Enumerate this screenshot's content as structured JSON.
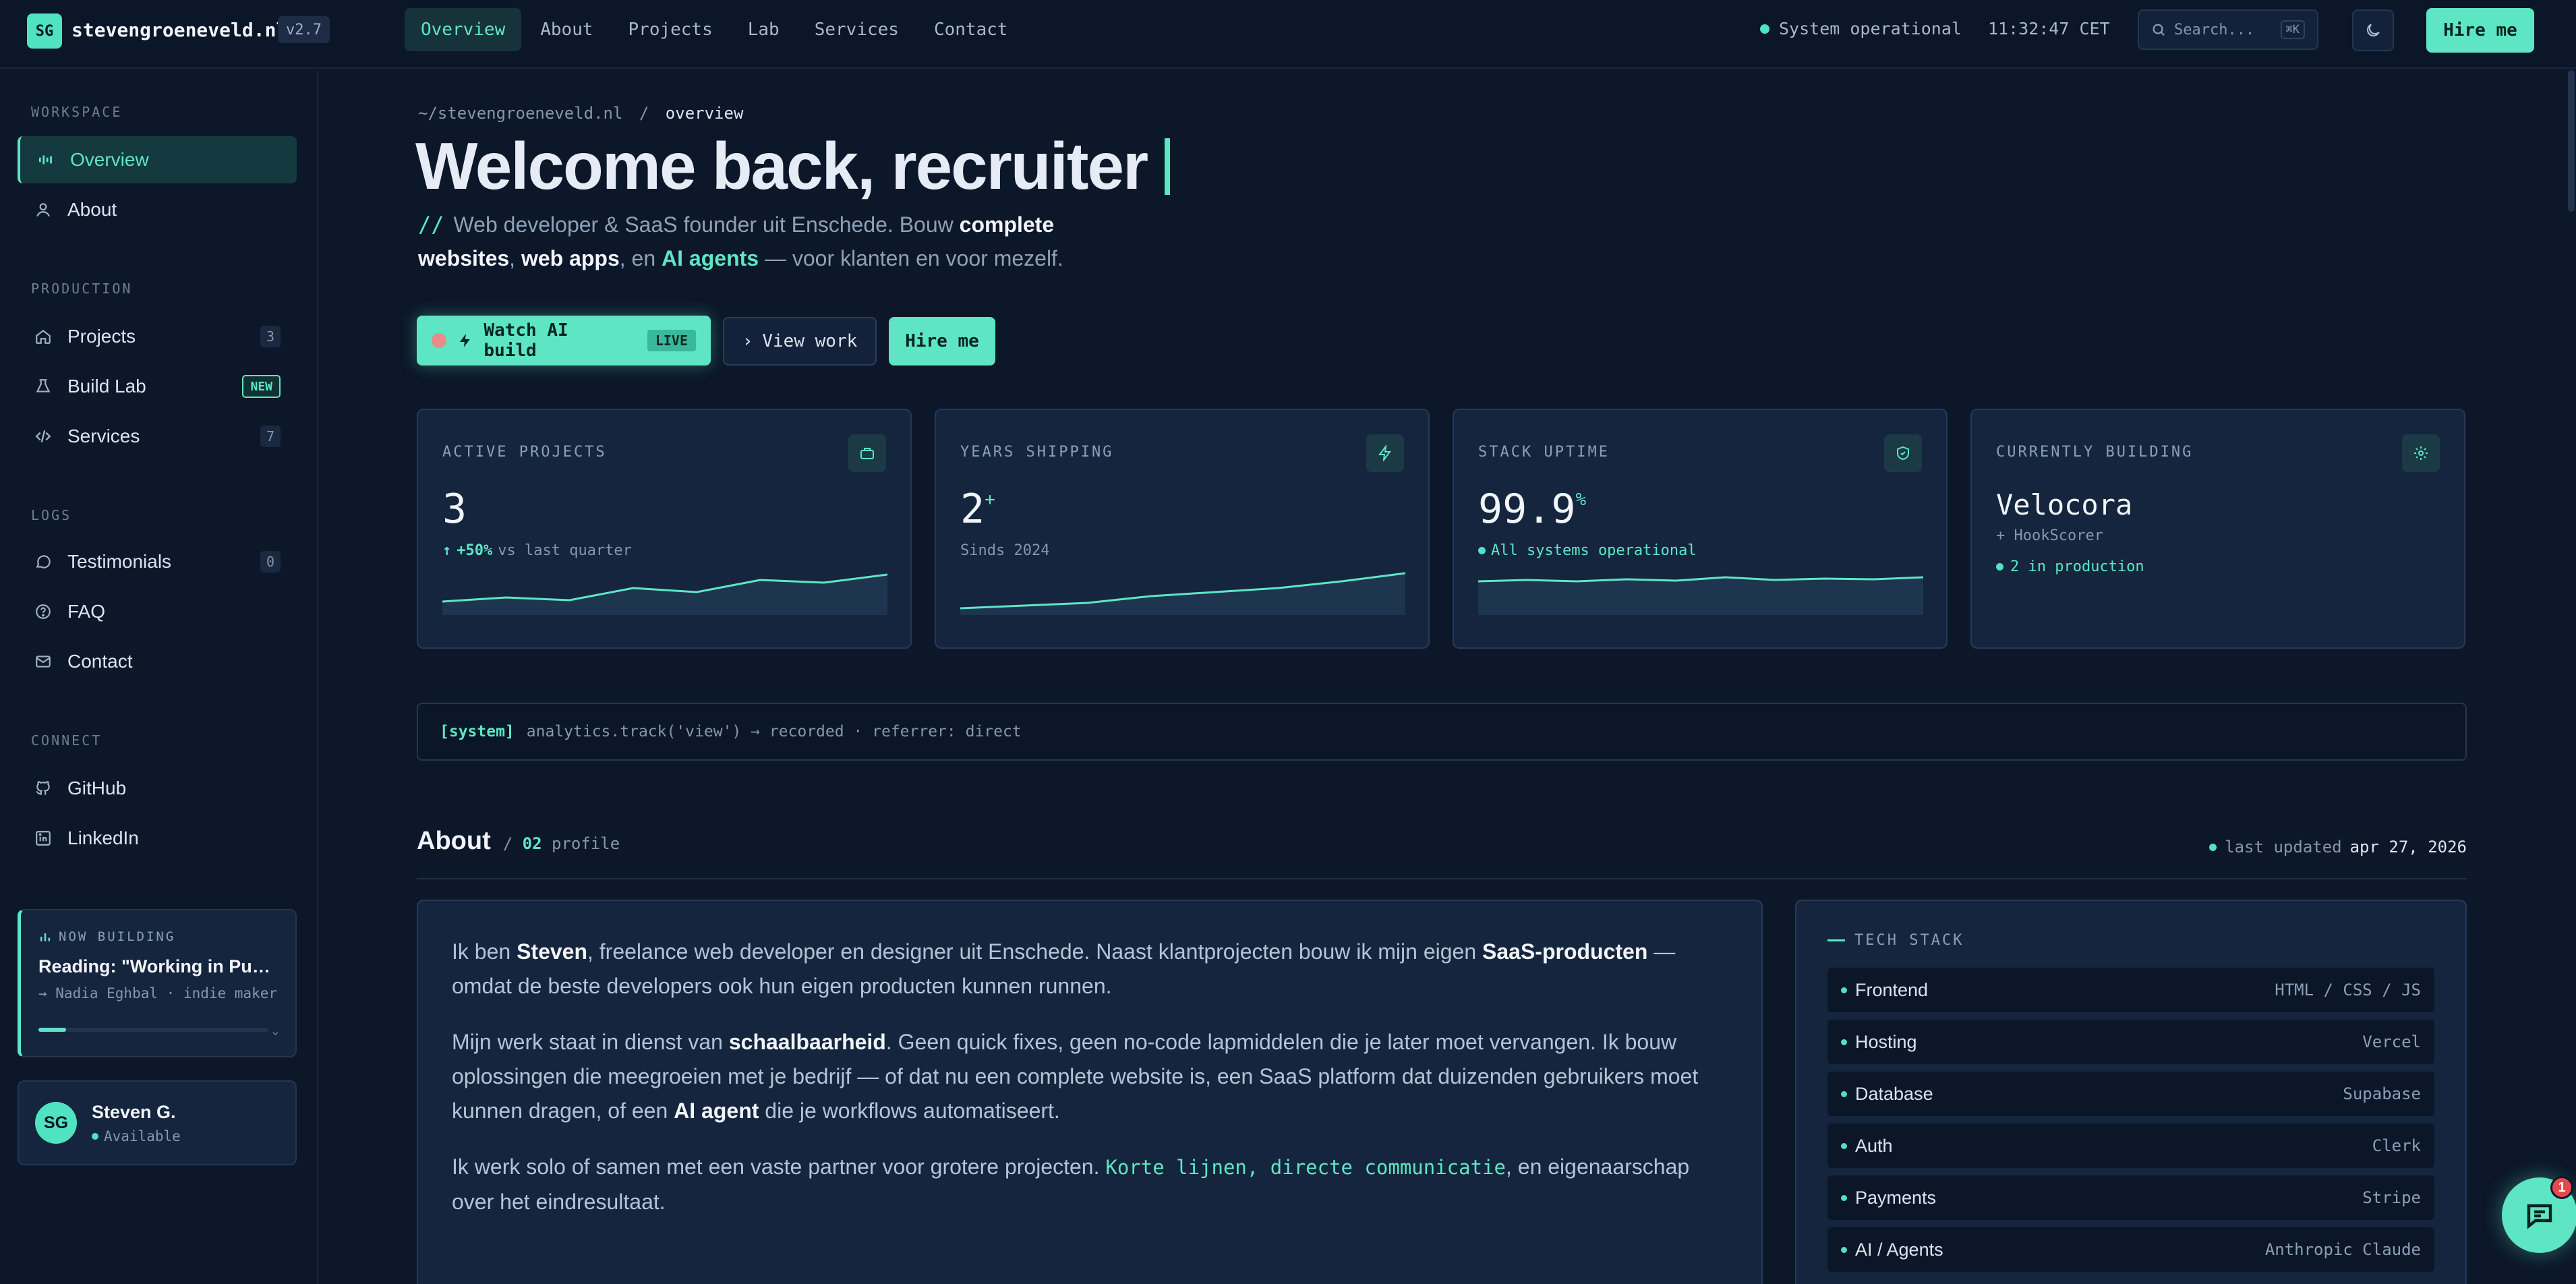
{
  "header": {
    "logo": "SG",
    "site_name": "stevengroeneveld.nl",
    "version": "v2.7",
    "nav": [
      {
        "label": "Overview",
        "active": true
      },
      {
        "label": "About"
      },
      {
        "label": "Projects"
      },
      {
        "label": "Lab"
      },
      {
        "label": "Services"
      },
      {
        "label": "Contact"
      }
    ],
    "status": "System operational",
    "clock": "11:32:47 CET",
    "search_placeholder": "Search...",
    "search_shortcut": "⌘K",
    "theme_icon": "moon-icon",
    "hire_label": "Hire me"
  },
  "sidebar": {
    "sections": {
      "workspace": "WORKSPACE",
      "production": "PRODUCTION",
      "logs": "LOGS",
      "connect": "CONNECT"
    },
    "items": {
      "overview": {
        "label": "Overview",
        "icon": "activity-icon"
      },
      "about": {
        "label": "About",
        "icon": "user-icon"
      },
      "projects": {
        "label": "Projects",
        "icon": "home-icon",
        "count": "3"
      },
      "build_lab": {
        "label": "Build Lab",
        "icon": "flask-icon",
        "badge": "NEW"
      },
      "services": {
        "label": "Services",
        "icon": "code-icon",
        "count": "7"
      },
      "testimonials": {
        "label": "Testimonials",
        "icon": "message-icon",
        "count": "0"
      },
      "faq": {
        "label": "FAQ",
        "icon": "help-icon"
      },
      "contact": {
        "label": "Contact",
        "icon": "mail-icon"
      },
      "github": {
        "label": "GitHub",
        "icon": "github-icon"
      },
      "linkedin": {
        "label": "LinkedIn",
        "icon": "linkedin-icon"
      }
    },
    "now_building": {
      "label": "NOW BUILDING",
      "title": "Reading: \"Working in Public\"",
      "subtitle": "→ Nadia Eghbal · indie maker",
      "progress": 0.12
    },
    "profile": {
      "initials": "SG",
      "name": "Steven G.",
      "status": "Available"
    }
  },
  "main": {
    "breadcrumb_root": "~/stevengroeneveld.nl",
    "breadcrumb_sep": "/",
    "breadcrumb_current": "overview",
    "title": "Welcome back, recruiter",
    "subtitle": {
      "slashes": "//",
      "p1": "Web developer & SaaS founder uit Enschede. Bouw ",
      "b1": "complete websites",
      "p2": ", ",
      "b2": "web apps",
      "p3": ", en ",
      "b3": "AI agents",
      "p4": " — voor klanten en voor mezelf."
    },
    "buttons": {
      "watch": "Watch AI build",
      "live": "LIVE",
      "view": "View work",
      "hire": "Hire me"
    },
    "stats": [
      {
        "label": "ACTIVE PROJECTS",
        "value": "3",
        "icon": "briefcase-icon",
        "delta": "+50%",
        "note": "vs last quarter",
        "spark": [
          20,
          26,
          22,
          40,
          34,
          52,
          48,
          60
        ]
      },
      {
        "label": "YEARS SHIPPING",
        "value": "2",
        "sup": "+",
        "icon": "bolt-icon",
        "note": "Sinds 2024",
        "spark": [
          10,
          14,
          18,
          28,
          34,
          40,
          50,
          62
        ]
      },
      {
        "label": "STACK UPTIME",
        "value": "99.9",
        "sup": "%",
        "icon": "shield-icon",
        "note": "All systems operational",
        "spark": [
          50,
          52,
          50,
          53,
          51,
          56,
          52,
          54,
          53,
          56
        ]
      },
      {
        "label": "CURRENTLY BUILDING",
        "value": "Velocora",
        "icon": "gear-icon",
        "note": "+ HookScorer",
        "note2": "2 in production"
      }
    ],
    "syslog": {
      "tag": "[system]",
      "text": "analytics.track('view') → recorded · referrer: direct"
    },
    "about": {
      "heading": "About",
      "sep": "/",
      "num": "02",
      "sub": "profile",
      "updated_label": "last updated",
      "updated_date": "apr 27, 2026",
      "p1": {
        "a": "Ik ben ",
        "b": "Steven",
        "c": ", freelance web developer en designer uit Enschede. Naast klantprojecten bouw ik mijn eigen ",
        "d": "SaaS-producten",
        "e": " — omdat de beste developers ook hun eigen producten kunnen runnen."
      },
      "p2": {
        "a": "Mijn werk staat in dienst van ",
        "b": "schaalbaarheid",
        "c": ". Geen quick fixes, geen no-code lapmiddelen die je later moet vervangen. Ik bouw oplossingen die meegroeien met je bedrijf — of dat nu een complete website is, een SaaS platform dat duizenden gebruikers moet kunnen dragen, of een ",
        "d": "AI agent",
        "e": " die je workflows automatiseert."
      },
      "p3": {
        "a": "Ik werk solo of samen met een vaste partner voor grotere projecten. ",
        "b": "Korte lijnen, directe communicatie",
        "c": ", en eigenaarschap over het eindresultaat."
      }
    },
    "tech_stack": {
      "title": "TECH STACK",
      "rows": [
        {
          "k": "Frontend",
          "v": "HTML / CSS / JS"
        },
        {
          "k": "Hosting",
          "v": "Vercel"
        },
        {
          "k": "Database",
          "v": "Supabase"
        },
        {
          "k": "Auth",
          "v": "Clerk"
        },
        {
          "k": "Payments",
          "v": "Stripe"
        },
        {
          "k": "AI / Agents",
          "v": "Anthropic Claude"
        }
      ]
    },
    "chat_badge": "1"
  },
  "colors": {
    "accent": "#5ee6c4",
    "bg": "#0c1729",
    "card": "#15253e",
    "badge": "#e5484d"
  }
}
